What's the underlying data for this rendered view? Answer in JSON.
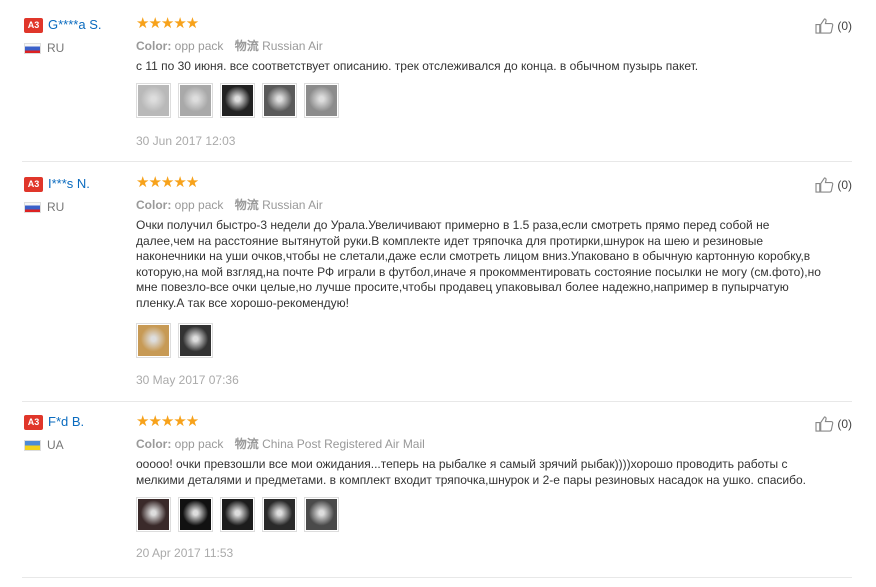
{
  "reviews": [
    {
      "badge": "A3",
      "name": "G****a S.",
      "country": "RU",
      "flag": "ru",
      "stars": "★★★★★",
      "color_label": "Color:",
      "color_value": "opp pack",
      "ship_label": "物流",
      "ship_value": "Russian Air",
      "text": "с 11 по 30 июня. все соответствует описанию. трек отслеживался до конца. в обычном пузырь пакет.",
      "photos": [
        "#b9b9b9",
        "#a9a9a9",
        "#222222",
        "#5a5a5a",
        "#8c8c8c"
      ],
      "date": "30 Jun 2017 12:03",
      "likes": "(0)"
    },
    {
      "badge": "A3",
      "name": "I***s N.",
      "country": "RU",
      "flag": "ru",
      "stars": "★★★★★",
      "color_label": "Color:",
      "color_value": "opp pack",
      "ship_label": "物流",
      "ship_value": "Russian Air",
      "text": "Очки получил быстро-3 недели до Урала.Увеличивают примерно в 1.5 раза,если смотреть прямо перед собой не далее,чем на расстояние вытянутой руки.В комплекте идет тряпочка для протирки,шнурок на шею и резиновые наконечники на уши очков,чтобы не слетали,даже если смотреть лицом вниз.Упаковано в обычную картонную коробку,в которую,на мой взгляд,на почте РФ играли в футбол,иначе я прокомментировать состояние посылки не могу (см.фото),но мне повезло-все очки целые,но лучше просите,чтобы продавец упаковывал более надежно,например в пупырчатую пленку.А так все хорошо-рекомендую!",
      "photos": [
        "#c79a55",
        "#333333"
      ],
      "date": "30 May 2017 07:36",
      "likes": "(0)"
    },
    {
      "badge": "A3",
      "name": "F*d B.",
      "country": "UA",
      "flag": "ua",
      "stars": "★★★★★",
      "color_label": "Color:",
      "color_value": "opp pack",
      "ship_label": "物流",
      "ship_value": "China Post Registered Air Mail",
      "text": "ооооо! очки превзошли все мои ожидания...теперь на рыбалке я самый зрячий рыбак))))хорошо проводить работы с мелкими деталями и предметами. в комплект входит тряпочка,шнурок и 2-е пары резиновых насадок на ушко. спасибо.",
      "photos": [
        "#3a2a2a",
        "#111111",
        "#1c1c1c",
        "#2a2a2a",
        "#4a4a4a"
      ],
      "date": "20 Apr 2017 11:53",
      "likes": "(0)"
    }
  ]
}
